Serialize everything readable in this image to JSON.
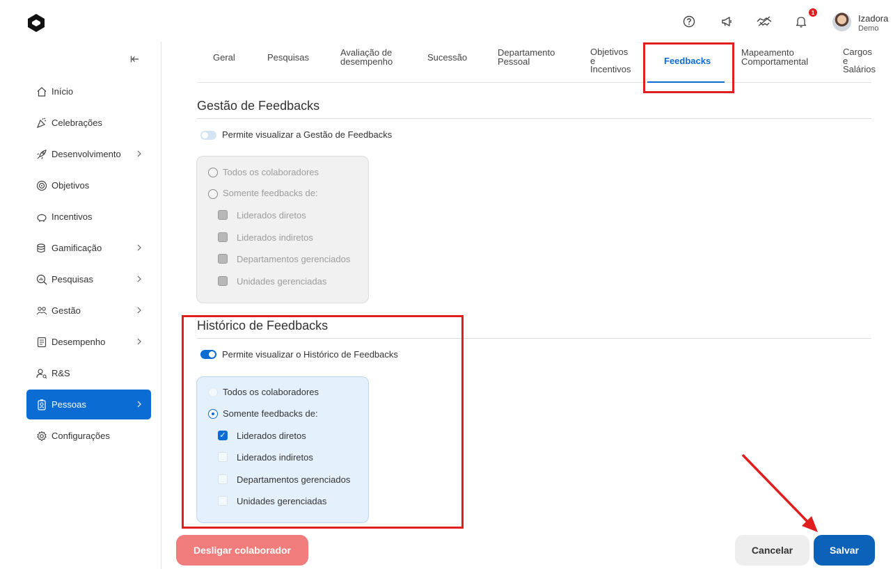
{
  "header": {
    "user_name": "Izadora",
    "user_sub": "Demo",
    "notification_count": "1",
    "icons": [
      "help-icon",
      "megaphone-icon",
      "handshake-icon",
      "bell-icon"
    ]
  },
  "sidebar": {
    "items": [
      {
        "label": "Início",
        "icon": "home-icon"
      },
      {
        "label": "Celebrações",
        "icon": "party-icon"
      },
      {
        "label": "Desenvolvimento",
        "icon": "rocket-icon"
      },
      {
        "label": "Objetivos",
        "icon": "target-icon"
      },
      {
        "label": "Incentivos",
        "icon": "piggy-bank-icon"
      },
      {
        "label": "Gamificação",
        "icon": "coins-icon"
      },
      {
        "label": "Pesquisas",
        "icon": "search-chart-icon"
      },
      {
        "label": "Gestão",
        "icon": "people-icon"
      },
      {
        "label": "Desempenho",
        "icon": "checklist-icon"
      },
      {
        "label": "R&S",
        "icon": "user-search-icon"
      },
      {
        "label": "Pessoas",
        "icon": "badge-icon"
      },
      {
        "label": "Configurações",
        "icon": "gear-icon"
      }
    ],
    "active_item": "Pessoas"
  },
  "tabs": {
    "geral": "Geral",
    "pesquisas": "Pesquisas",
    "avaliacao_1": "Avaliação de",
    "avaliacao_2": "desempenho",
    "sucessao": "Sucessão",
    "departamento_1": "Departamento",
    "departamento_2": "Pessoal",
    "objetivos_1": "Objetivos",
    "objetivos_2": "e",
    "objetivos_3": "Incentivos",
    "feedbacks": "Feedbacks",
    "mapeamento_1": "Mapeamento",
    "mapeamento_2": "Comportamental",
    "cargos_1": "Cargos",
    "cargos_2": "e",
    "cargos_3": "Salários",
    "active": "Feedbacks"
  },
  "gestao": {
    "title": "Gestão de Feedbacks",
    "toggle_label": "Permite visualizar a Gestão de Feedbacks",
    "toggle_on": false,
    "radio_all": "Todos os colaboradores",
    "radio_some": "Somente feedbacks de:",
    "options": [
      "Liderados diretos",
      "Liderados indiretos",
      "Departamentos gerenciados",
      "Unidades gerenciadas"
    ]
  },
  "historico": {
    "title": "Histórico de Feedbacks",
    "toggle_label": "Permite visualizar o Histórico de Feedbacks",
    "toggle_on": true,
    "radio_all": "Todos os colaboradores",
    "radio_some": "Somente feedbacks de:",
    "selected_radio": "Somente feedbacks de:",
    "options": [
      "Liderados diretos",
      "Liderados indiretos",
      "Departamentos gerenciados",
      "Unidades gerenciadas"
    ],
    "checked_options": [
      "Liderados diretos"
    ]
  },
  "footer": {
    "danger_label": "Desligar colaborador",
    "cancel_label": "Cancelar",
    "save_label": "Salvar"
  },
  "colors": {
    "primary": "#0b6cd3",
    "highlight": "#e01e1e",
    "danger": "#f07c7c"
  }
}
